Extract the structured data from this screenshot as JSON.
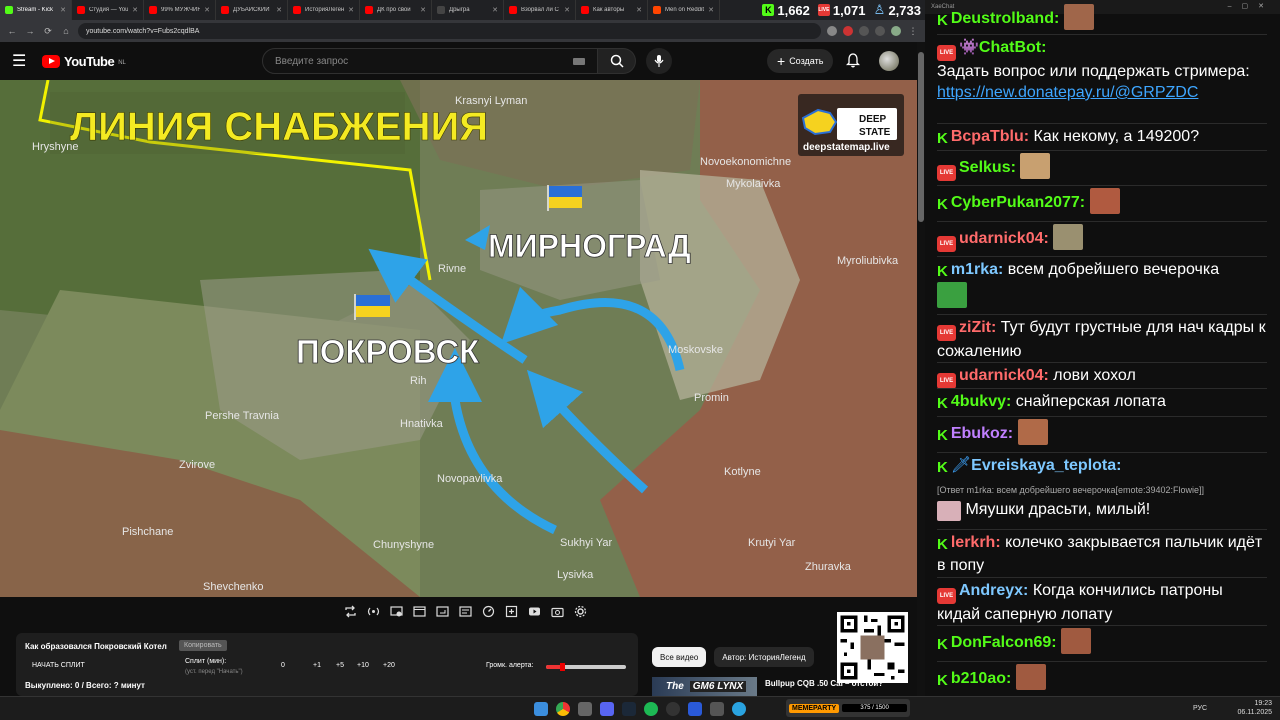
{
  "browser": {
    "tabs": [
      {
        "label": "Stream - Kick",
        "color": "#53fc18"
      },
      {
        "label": "Студия — YouTube",
        "color": "#ff0000"
      },
      {
        "label": "99% МУЖЧИН",
        "color": "#ff0000"
      },
      {
        "label": "ДУБАЙСКИЙ",
        "color": "#ff0000"
      },
      {
        "label": "ИсторияЛегенд",
        "color": "#ff0000"
      },
      {
        "label": "ДК про свой",
        "color": "#ff0000"
      },
      {
        "label": "Дрыгра",
        "color": "#444444"
      },
      {
        "label": "Взорвал ли С",
        "color": "#ff0000"
      },
      {
        "label": "Как авторы",
        "color": "#ff0000"
      },
      {
        "label": "Men on Reddit",
        "color": "#ff4500"
      }
    ],
    "url": "youtube.com/watch?v=Fubs2cqdlBA"
  },
  "stats": {
    "kick": "1,662",
    "live": "1,071",
    "viewers": "2,733"
  },
  "youtube": {
    "logo": "YouTube",
    "country": "NL",
    "search_placeholder": "Введите запрос",
    "create_label": "Создать"
  },
  "map": {
    "title": "ЛИНИЯ СНАБЖЕНИЯ",
    "city_main": "ПОКРОВСК",
    "city_second": "МИРНОГРАД",
    "watermark": "deepstatemap.live",
    "badge_line1": "DEEP",
    "badge_line2": "STATE",
    "places": [
      {
        "name": "Krasnyi Lyman"
      },
      {
        "name": "Hryshyne"
      },
      {
        "name": "Novoekonomichne"
      },
      {
        "name": "Mykolaivka"
      },
      {
        "name": "Myroliubivka"
      },
      {
        "name": "Rivne"
      },
      {
        "name": "Moskovske"
      },
      {
        "name": "Rih"
      },
      {
        "name": "Promin"
      },
      {
        "name": "Pershe Travnia"
      },
      {
        "name": "Hnativka"
      },
      {
        "name": "Zvirove"
      },
      {
        "name": "Novopavlivka"
      },
      {
        "name": "Sukhyi Yar"
      },
      {
        "name": "Pishchane"
      },
      {
        "name": "Chunyshyne"
      },
      {
        "name": "Kotlyne"
      },
      {
        "name": "Krutyi Yar"
      },
      {
        "name": "Lysivka"
      },
      {
        "name": "Shevchenko"
      },
      {
        "name": "Zhuravka"
      }
    ]
  },
  "panel": {
    "title": "Как образовался Покровский Котел",
    "copy": "Копировать",
    "start": "НАЧАТЬ СПЛИТ",
    "split_label": "Сплит (мин):",
    "split_hint": "(уст. перед \"Начать\")",
    "value": "0",
    "steps": [
      "+1",
      "+5",
      "+10",
      "+20"
    ],
    "alert_label": "Громк. алерта:",
    "alert_level": 0.2,
    "status": "Выкуплено: 0 / Всего: ? минут"
  },
  "chips": [
    "Все видео",
    "Автор: ИсторияЛегенд"
  ],
  "recommended": {
    "thumb_word": "The",
    "thumb_badge": "GM6 LYNX",
    "title": "Bullpup CQB .50 Cal – отстой?"
  },
  "chat": {
    "window_title": "XaeChat",
    "messages": [
      {
        "badge": "kick",
        "nick": "Deustrolband:",
        "color": "#53fc18",
        "text": ""
      },
      {
        "badge": "live",
        "nick": "ChatBot:",
        "color": "#53fc18",
        "text": "Задать вопрос или поддержать стримера:",
        "link": "https://new.donatepay.ru/@GRPZDC"
      },
      {
        "badge": "kick",
        "nick": "BcpaTblu:",
        "color": "#ff6b6b",
        "text": "Как некому, а 149200?"
      },
      {
        "badge": "live",
        "nick": "Selkus:",
        "color": "#53fc18",
        "text": ""
      },
      {
        "badge": "kick",
        "nick": "CyberPukan2077:",
        "color": "#53fc18",
        "text": ""
      },
      {
        "badge": "live",
        "nick": "udarnick04:",
        "color": "#ff6b6b",
        "text": ""
      },
      {
        "badge": "kick",
        "nick": "m1rka:",
        "color": "#7ec8ff",
        "text": "всем добрейшего вечерочка"
      },
      {
        "badge": "live",
        "nick": "ziZit:",
        "color": "#ff6b6b",
        "text": "Тут будут грустные для нач кадры к сожалению"
      },
      {
        "badge": "live",
        "nick": "udarnick04:",
        "color": "#ff6b6b",
        "text": "лови хохол"
      },
      {
        "badge": "kick",
        "nick": "4bukvy:",
        "color": "#53fc18",
        "text": "снайперская лопата"
      },
      {
        "badge": "kick",
        "nick": "Ebukoz:",
        "color": "#c080ff",
        "text": ""
      },
      {
        "badge": "kick",
        "nick": "Evreiskaya_teplota:",
        "color": "#7ec8ff",
        "text": "",
        "reply": "[Ответ m1rka: всем добрейшего вечерочка[emote:39402:Flowie]]",
        "body": "Мяушки драсьти, милый!"
      },
      {
        "badge": "kick",
        "nick": "lerkrh:",
        "color": "#ff6b6b",
        "text": "колечко закрывается пальчик идёт в попу"
      },
      {
        "badge": "live",
        "nick": "Andreyx:",
        "color": "#7ec8ff",
        "text": "Когда кончились патроны кидай саперную лопату"
      },
      {
        "badge": "kick",
        "nick": "DonFalcon69:",
        "color": "#53fc18",
        "text": ""
      },
      {
        "badge": "kick",
        "nick": "b210ao:",
        "color": "#53fc18",
        "text": ""
      }
    ]
  },
  "taskbar": {
    "meme_label": "MEMEPARTY",
    "meme_count": "375 / 1500",
    "lang": "РУС",
    "time": "19:23",
    "date": "06.11.2025"
  }
}
